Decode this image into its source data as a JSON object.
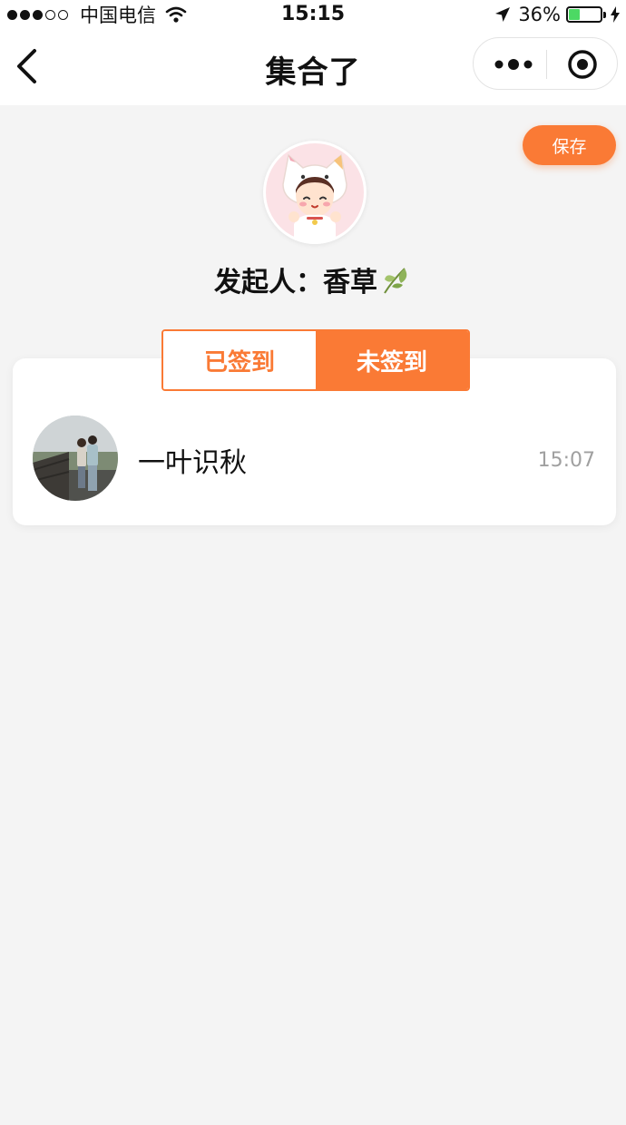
{
  "status_bar": {
    "carrier": "中国电信",
    "time": "15:15",
    "battery": "36%",
    "battery_level": 0.36,
    "signal_bars": 3
  },
  "nav": {
    "title": "集合了",
    "back_icon": "chevron-left-icon",
    "more_icon": "more-dots-icon",
    "close_icon": "target-close-icon"
  },
  "save_label": "保存",
  "organizer": {
    "label": "发起人：",
    "name": "香草",
    "leaf_icon": "leaf-icon"
  },
  "tabs": [
    {
      "label": "已签到",
      "active": false
    },
    {
      "label": "未签到",
      "active": true
    }
  ],
  "members": [
    {
      "name": "一叶识秋",
      "time": "15:07"
    }
  ],
  "colors": {
    "accent": "#fa7a35",
    "background": "#f4f4f4",
    "battery_fill": "#4cd964",
    "time_gray": "#a0a0a0"
  }
}
